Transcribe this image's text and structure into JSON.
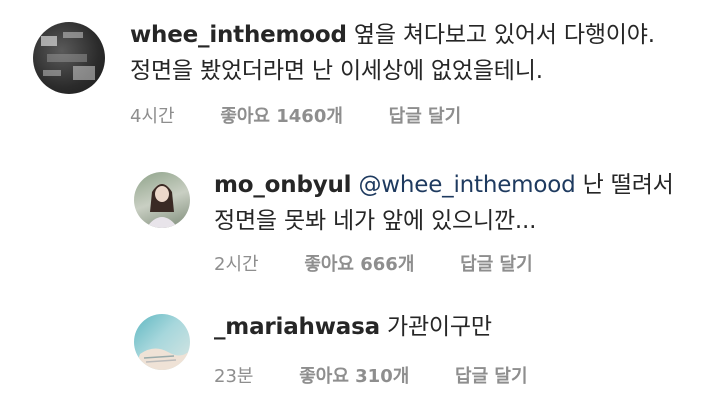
{
  "comments": [
    {
      "username": "whee_inthemood",
      "text_line1": "옆을 쳐다보고 있어서 다행이야.",
      "text_line2": "정면을 봤었더라면 난 이세상에 없었을테니.",
      "time": "4시간",
      "likes": "좋아요 1460개",
      "reply": "답글 달기"
    },
    {
      "username": "mo_onbyul",
      "mention": "@whee_inthemood",
      "text_line1": "난 떨려서",
      "text_line2": "정면을 못봐 네가 앞에 있으니깐...",
      "time": "2시간",
      "likes": "좋아요 666개",
      "reply": "답글 달기"
    },
    {
      "username": "_mariahwasa",
      "text_line1": "가관이구만",
      "time": "23분",
      "likes": "좋아요 310개",
      "reply": "답글 달기"
    }
  ]
}
